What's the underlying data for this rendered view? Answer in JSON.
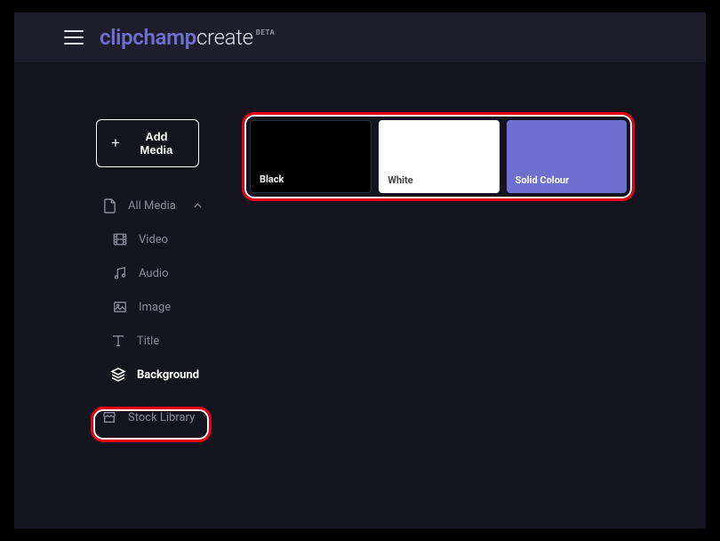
{
  "header": {
    "brand": "clipchamp",
    "product": "create",
    "badge": "BETA"
  },
  "sidebar": {
    "add_media": "Add Media",
    "all_media": "All Media",
    "items": [
      {
        "label": "Video"
      },
      {
        "label": "Audio"
      },
      {
        "label": "Image"
      },
      {
        "label": "Title"
      },
      {
        "label": "Background"
      },
      {
        "label": "Stock Library"
      }
    ]
  },
  "backgrounds": [
    {
      "label": "Black",
      "color": "#000000"
    },
    {
      "label": "White",
      "color": "#ffffff"
    },
    {
      "label": "Solid Colour",
      "color": "#6f6fd0"
    }
  ]
}
